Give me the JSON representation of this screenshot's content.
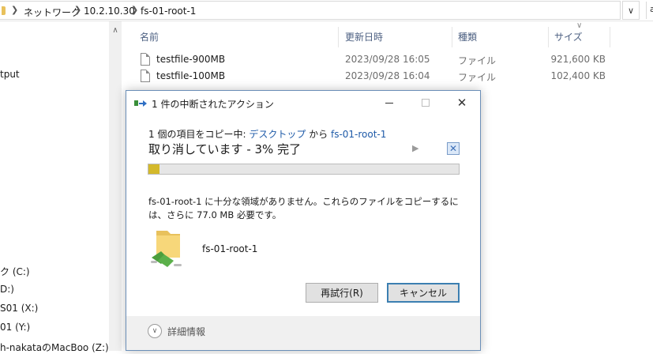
{
  "address_bar": {
    "crumbs": [
      "ネットワーク",
      "10.2.10.30",
      "fs-01-root-1"
    ],
    "cut_text": "a"
  },
  "nav_pane": {
    "items": [
      "tput",
      "ク (C:)",
      "D:)",
      "S01 (X:)",
      "01 (Y:)",
      "h-nakataのMacBoo (Z:)"
    ]
  },
  "file_list": {
    "columns": [
      "名前",
      "更新日時",
      "種類",
      "サイズ"
    ],
    "rows": [
      {
        "name": "testfile-900MB",
        "date": "2023/09/28 16:05",
        "type": "ファイル",
        "size": "921,600 KB"
      },
      {
        "name": "testfile-100MB",
        "date": "2023/09/28 16:04",
        "type": "ファイル",
        "size": "102,400 KB"
      }
    ]
  },
  "dialog": {
    "title": "1 件の中断されたアクション",
    "copy_prefix": "1 個の項目をコピー中: ",
    "source": "デスクトップ",
    "connector": " から ",
    "destination": "fs-01-root-1",
    "status": "取り消しています - 3% 完了",
    "progress_percent": 3,
    "message": "fs-01-root-1 に十分な領域がありません。これらのファイルをコピーするには、さらに 77.0 MB 必要です。",
    "folder_name": "fs-01-root-1",
    "retry_label": "再試行(R)",
    "cancel_label": "キャンセル",
    "details_label": "詳細情報",
    "progress_color": "#d4b92b"
  }
}
